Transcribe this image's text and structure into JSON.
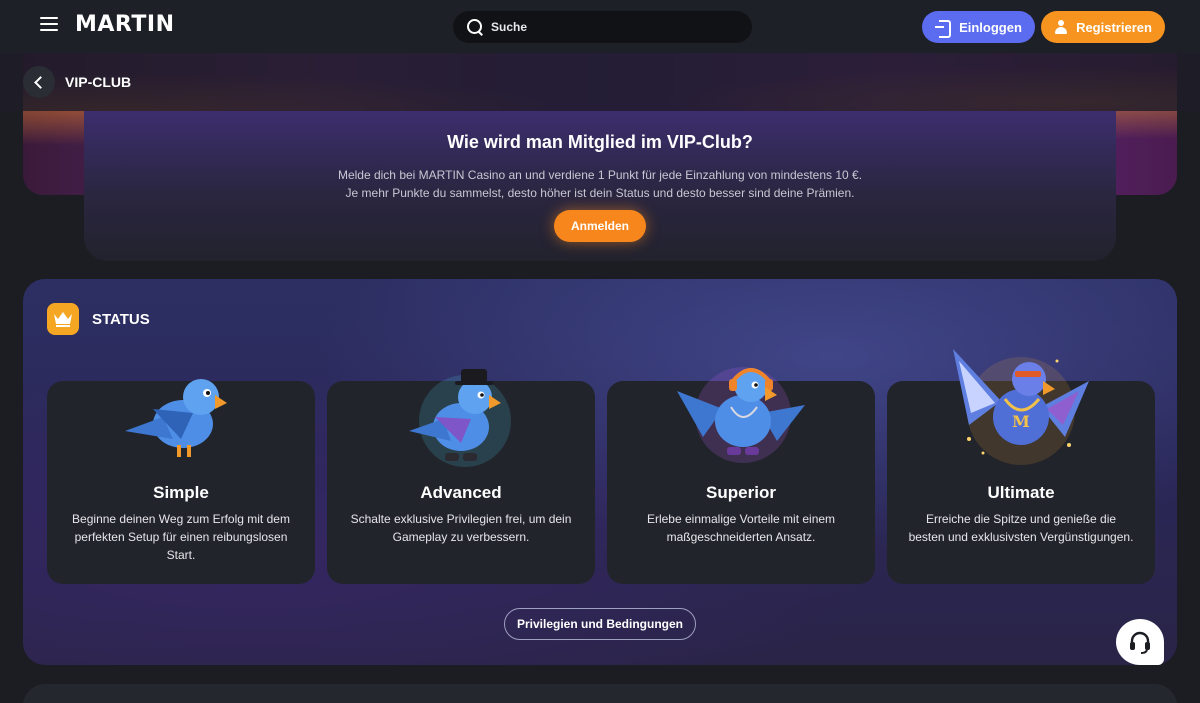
{
  "header": {
    "logo": "MARTIN",
    "search_placeholder": "Suche",
    "login_label": "Einloggen",
    "register_label": "Registrieren"
  },
  "breadcrumb": {
    "label": "VIP-CLUB"
  },
  "join": {
    "title": "Wie wird man Mitglied im VIP-Club?",
    "line1": "Melde dich bei MARTIN Casino an und verdiene 1 Punkt für jede Einzahlung von mindestens 10 €.",
    "line2": "Je mehr Punkte du sammelst, desto höher ist dein Status und desto besser sind deine Prämien.",
    "button": "Anmelden"
  },
  "status": {
    "title": "STATUS",
    "tiers": [
      {
        "name": "Simple",
        "description": "Beginne deinen Weg zum Erfolg mit dem perfekten Setup für einen reibungslosen Start."
      },
      {
        "name": "Advanced",
        "description": "Schalte exklusive Privilegien frei, um dein Gameplay zu verbessern."
      },
      {
        "name": "Superior",
        "description": "Erlebe einmalige Vorteile mit einem maßgeschneiderten Ansatz."
      },
      {
        "name": "Ultimate",
        "description": "Erreiche die Spitze und genieße die besten und exklusivsten Vergünstigungen."
      }
    ],
    "privileges_button": "Privilegien und Bedingungen"
  },
  "colors": {
    "login": "#5b6cf0",
    "register": "#f79420",
    "signup": "#f7871d",
    "crown": "#f5a623"
  }
}
